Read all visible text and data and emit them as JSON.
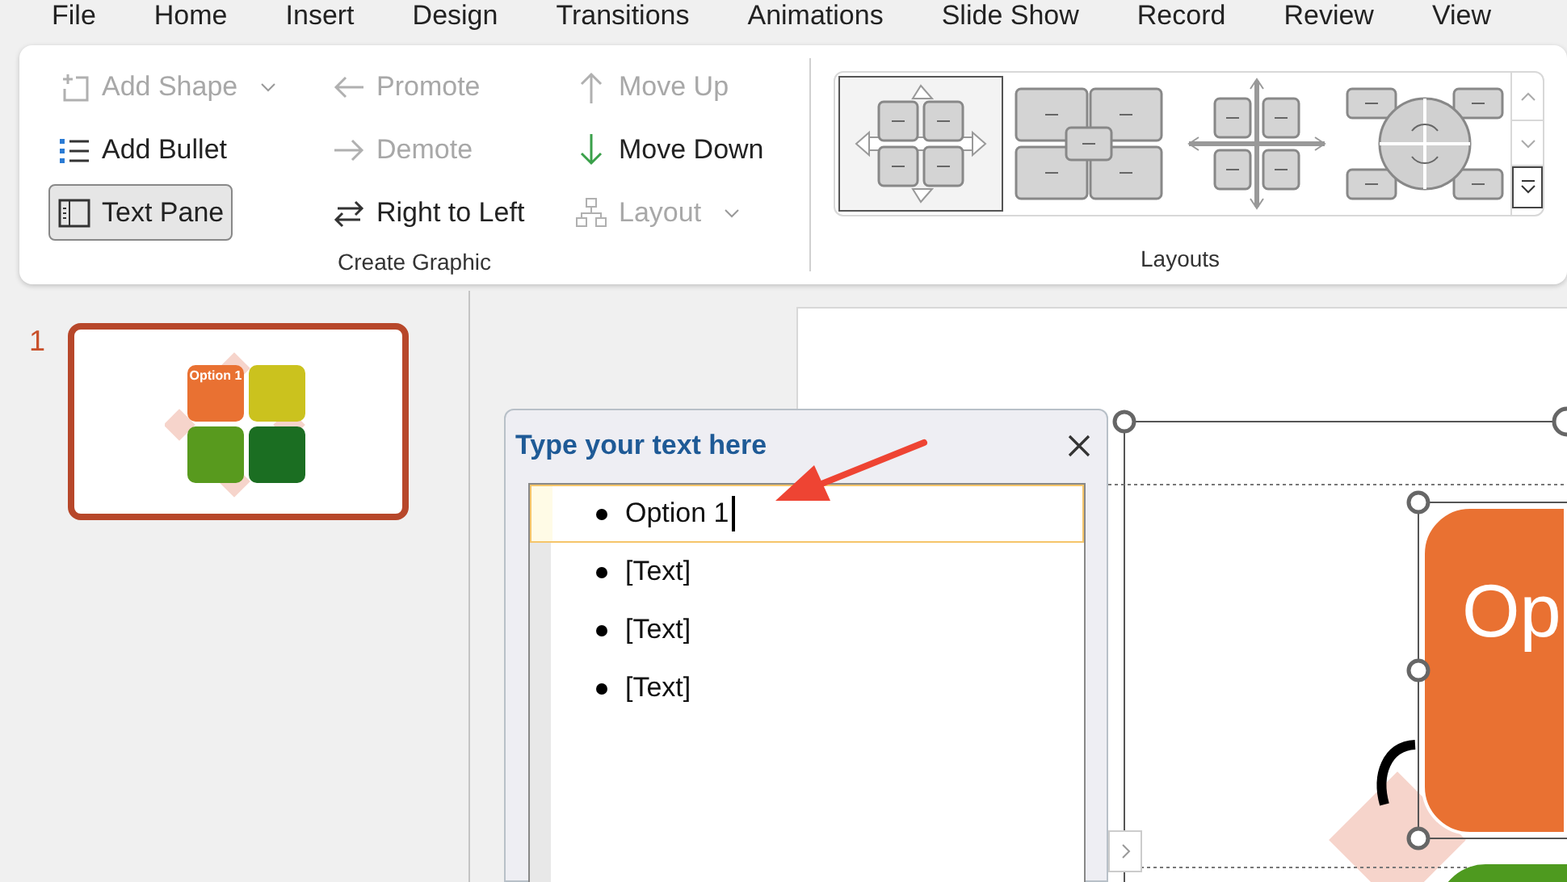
{
  "menu_tabs": [
    {
      "label": "File"
    },
    {
      "label": "Home"
    },
    {
      "label": "Insert"
    },
    {
      "label": "Design"
    },
    {
      "label": "Transitions"
    },
    {
      "label": "Animations"
    },
    {
      "label": "Slide Show"
    },
    {
      "label": "Record"
    },
    {
      "label": "Review"
    },
    {
      "label": "View"
    }
  ],
  "ribbon": {
    "create_graphic": {
      "label": "Create Graphic",
      "columns": [
        [
          {
            "label": "Add Shape",
            "disabled": true,
            "dropdown": true,
            "on": false
          },
          {
            "label": "Add Bullet",
            "disabled": false,
            "dropdown": false,
            "on": false
          },
          {
            "label": "Text Pane",
            "disabled": false,
            "dropdown": false,
            "on": true
          }
        ],
        [
          {
            "label": "Promote",
            "disabled": true,
            "dropdown": false,
            "on": false
          },
          {
            "label": "Demote",
            "disabled": true,
            "dropdown": false,
            "on": false
          },
          {
            "label": "Right to Left",
            "disabled": false,
            "dropdown": false,
            "on": false
          }
        ],
        [
          {
            "label": "Move Up",
            "disabled": true,
            "dropdown": false,
            "on": false
          },
          {
            "label": "Move Down",
            "disabled": false,
            "dropdown": false,
            "on": false
          },
          {
            "label": "Layout",
            "disabled": true,
            "dropdown": true,
            "on": false
          }
        ]
      ]
    },
    "layouts": {
      "label": "Layouts",
      "items": [
        {
          "kind": "basic-matrix",
          "selected": true
        },
        {
          "kind": "titled-matrix",
          "selected": false
        },
        {
          "kind": "grid-matrix",
          "selected": false
        },
        {
          "kind": "cycle-matrix",
          "selected": false
        }
      ]
    }
  },
  "slides": [
    {
      "number": "1",
      "selected": true,
      "thumbnail_text": "Option 1"
    }
  ],
  "text_pane": {
    "title": "Type your text here",
    "items": [
      {
        "text": "Option 1",
        "selected": true
      },
      {
        "text": "[Text]",
        "selected": false
      },
      {
        "text": "[Text]",
        "selected": false
      },
      {
        "text": "[Text]",
        "selected": false
      }
    ]
  },
  "slide": {
    "shape_text": "Op"
  }
}
